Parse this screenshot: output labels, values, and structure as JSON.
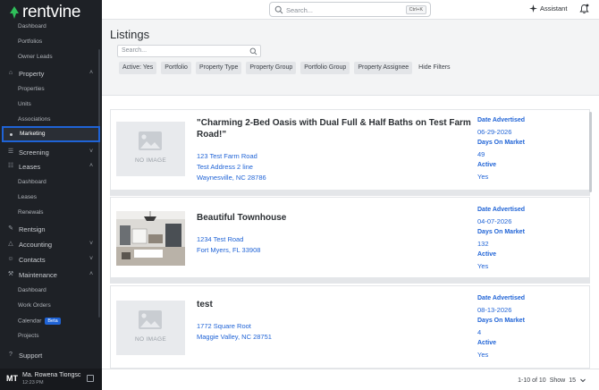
{
  "brand": {
    "name": "rentvine",
    "accent": "#2fbf5a"
  },
  "topbar": {
    "search_placeholder": "Search...",
    "shortcut": "Ctrl+K",
    "assistant_label": "Assistant"
  },
  "sidebar": {
    "items": [
      {
        "label": "Dashboard",
        "type": "sub"
      },
      {
        "label": "Portfolios",
        "type": "sub"
      },
      {
        "label": "Owner Leads",
        "type": "sub"
      },
      {
        "label": "Property",
        "type": "head",
        "icon": "building-icon"
      },
      {
        "label": "Properties",
        "type": "sub"
      },
      {
        "label": "Units",
        "type": "sub"
      },
      {
        "label": "Associations",
        "type": "sub"
      },
      {
        "label": "Marketing",
        "type": "active"
      },
      {
        "label": "Screening",
        "type": "head",
        "icon": "screening-icon"
      },
      {
        "label": "Leases",
        "type": "head",
        "icon": "lease-icon"
      },
      {
        "label": "Dashboard",
        "type": "sub"
      },
      {
        "label": "Leases",
        "type": "sub"
      },
      {
        "label": "Renewals",
        "type": "sub"
      },
      {
        "label": "Rentsign",
        "type": "head",
        "icon": "pen-icon"
      },
      {
        "label": "Accounting",
        "type": "head",
        "icon": "bank-icon"
      },
      {
        "label": "Contacts",
        "type": "head",
        "icon": "contacts-icon"
      },
      {
        "label": "Maintenance",
        "type": "head",
        "icon": "wrench-icon"
      },
      {
        "label": "Dashboard",
        "type": "sub"
      },
      {
        "label": "Work Orders",
        "type": "sub"
      },
      {
        "label": "Calendar",
        "type": "sub",
        "badge": "Beta"
      },
      {
        "label": "Projects",
        "type": "sub"
      },
      {
        "label": "Support",
        "type": "head",
        "icon": "help-icon"
      }
    ],
    "user": {
      "initials": "MT",
      "name": "Ma. Rowena Tiongsc",
      "time": "12:23 PM"
    }
  },
  "page": {
    "title": "Listings",
    "search_placeholder": "Search...",
    "filters": [
      "Active: Yes",
      "Portfolio",
      "Property Type",
      "Property Group",
      "Portfolio Group",
      "Property Assignee"
    ],
    "hide_filters_label": "Hide Filters"
  },
  "listings": [
    {
      "title": "\"Charming 2-Bed Oasis with Dual Full & Half Baths on Test Farm Road!\"",
      "address": [
        "123 Test Farm Road",
        "Test Address 2 line",
        "Waynesville, NC 28786"
      ],
      "has_image": false,
      "date_label": "Date Advertised",
      "date": "06-29-2026",
      "dom_label": "Days On Market",
      "dom": "49",
      "active_label": "Active",
      "active": "Yes"
    },
    {
      "title": "Beautiful Townhouse",
      "address": [
        "1234 Test Road",
        "Fort Myers, FL 33908"
      ],
      "has_image": true,
      "date_label": "Date Advertised",
      "date": "04-07-2026",
      "dom_label": "Days On Market",
      "dom": "132",
      "active_label": "Active",
      "active": "Yes"
    },
    {
      "title": "test",
      "address": [
        "1772 Square Root",
        "Maggie Valley, NC 28751"
      ],
      "has_image": false,
      "date_label": "Date Advertised",
      "date": "08-13-2026",
      "dom_label": "Days On Market",
      "dom": "4",
      "active_label": "Active",
      "active": "Yes"
    }
  ],
  "no_image_label": "NO IMAGE",
  "pager": {
    "range": "1-10 of 10",
    "show_label": "Show",
    "show_value": "15"
  }
}
